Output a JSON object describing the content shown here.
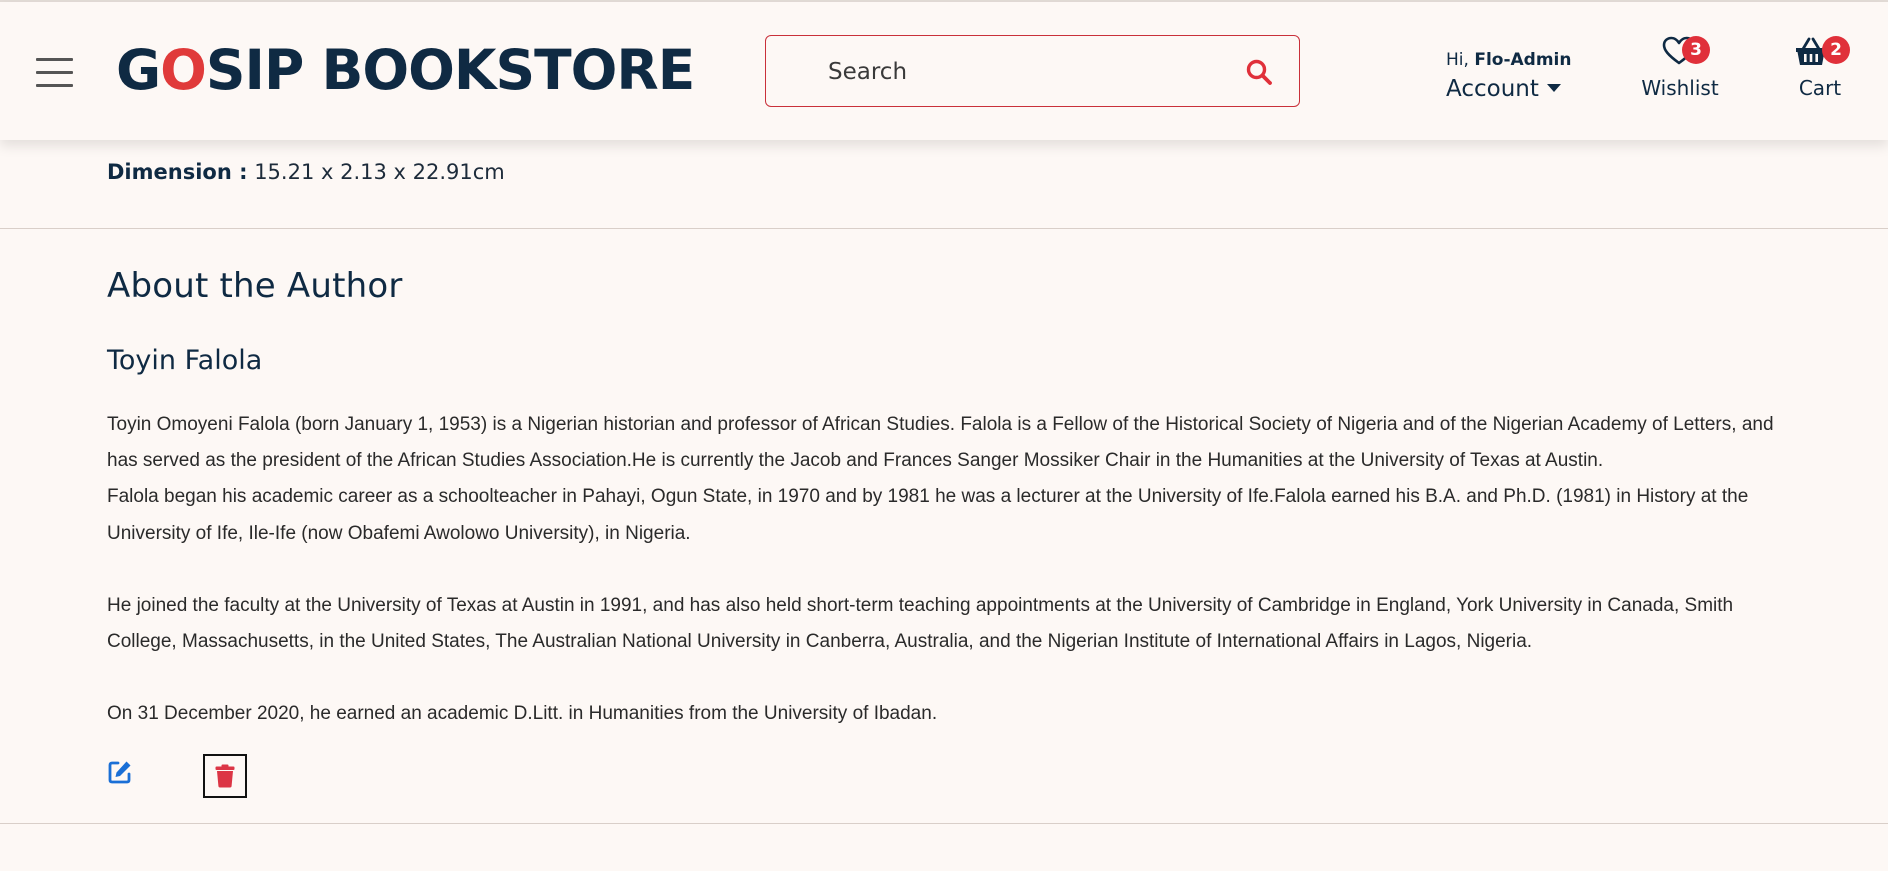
{
  "header": {
    "logo": {
      "part1": "G",
      "accent": "O",
      "part2": "SIP BOOKSTORE"
    },
    "search": {
      "placeholder": "Search"
    },
    "account": {
      "greeting": "Hi,",
      "username": "Flo-Admin",
      "label": "Account"
    },
    "wishlist": {
      "label": "Wishlist",
      "count": "3"
    },
    "cart": {
      "label": "Cart",
      "count": "2"
    }
  },
  "product": {
    "dimension_label": "Dimension :",
    "dimension_value": "15.21 x 2.13 x 22.91cm"
  },
  "about": {
    "title": "About the Author",
    "author_name": "Toyin Falola",
    "paragraphs": [
      "Toyin Omoyeni Falola (born January 1, 1953) is a Nigerian historian and professor of African Studies. Falola is a Fellow of the Historical Society of Nigeria and of the Nigerian Academy of Letters, and has served as the president of the African Studies Association.He is currently the Jacob and Frances Sanger Mossiker Chair in the Humanities at the University of Texas at Austin.",
      "Falola began his academic career as a schoolteacher in Pahayi, Ogun State, in 1970 and by 1981 he was a lecturer at the University of Ife.Falola earned his B.A. and Ph.D. (1981) in History at the University of Ife, Ile-Ife (now Obafemi Awolowo University), in Nigeria.",
      "He joined the faculty at the University of Texas at Austin in 1991, and has also held short-term teaching appointments at the University of Cambridge in England, York University in Canada, Smith College, Massachusetts, in the United States, The Australian National University in Canberra, Australia, and the Nigerian Institute of International Affairs in Lagos, Nigeria.",
      "On 31 December 2020, he earned an academic D.Litt. in Humanities from the University of Ibadan."
    ]
  },
  "actions": {
    "edit_icon": "edit-icon",
    "delete_icon": "trash-icon"
  },
  "colors": {
    "background": "#fdf8f5",
    "navy": "#0f2a43",
    "accent_red": "#e03a3a",
    "search_border": "#c9303a",
    "edit_blue": "#1a6fd6",
    "delete_red": "#dc3545"
  }
}
